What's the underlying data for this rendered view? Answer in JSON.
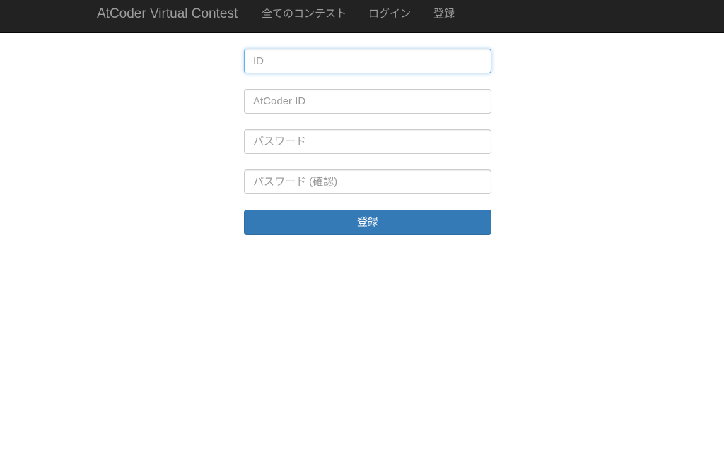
{
  "navbar": {
    "brand": "AtCoder Virtual Contest",
    "links": [
      {
        "label": "全てのコンテスト"
      },
      {
        "label": "ログイン"
      },
      {
        "label": "登録"
      }
    ]
  },
  "form": {
    "id_field": {
      "placeholder": "ID",
      "value": ""
    },
    "atcoder_id_field": {
      "placeholder": "AtCoder ID",
      "value": ""
    },
    "password_field": {
      "placeholder": "パスワード",
      "value": ""
    },
    "password_confirm_field": {
      "placeholder": "パスワード (確認)",
      "value": ""
    },
    "submit_label": "登録"
  },
  "colors": {
    "navbar_bg": "#222222",
    "navbar_text": "#9d9d9d",
    "primary_button": "#337ab7",
    "focus_border": "#66afe9"
  }
}
